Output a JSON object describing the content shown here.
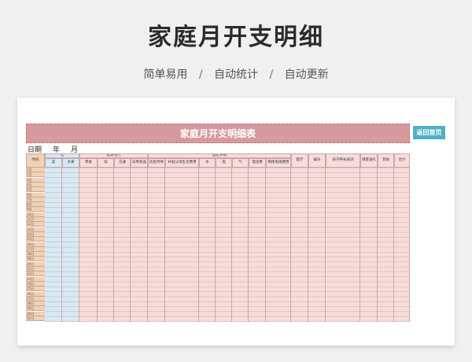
{
  "title": "家庭月开支明细",
  "subtitle": [
    "简单易用",
    "自动统计",
    "自动更新"
  ],
  "subtitle_sep": "/",
  "sheet": {
    "banner": "家庭月开支明细表",
    "home_button": "返回首页",
    "date_label": "日期",
    "year_label": "年",
    "month_label": "月",
    "headers": {
      "time": "时间",
      "eat": "吃",
      "vegetables": "菜",
      "fruit": "水果",
      "living_group": "给穿住行",
      "snacks": "零食",
      "wear": "穿",
      "transport": "交通",
      "daily_goods": "日用商品",
      "fixed_group": "固定开销",
      "rent": "房屋月供",
      "parents": "补贴父母生活费用",
      "water": "水",
      "electricity": "电",
      "gas": "气",
      "phone": "电话费",
      "internet": "网络电视费用",
      "medical": "医疗",
      "entertainment": "娱乐",
      "child_training": "孩子特长培训",
      "gifts": "请客送礼",
      "other": "其他",
      "total": "合计"
    },
    "days": [
      "1日",
      "2日",
      "3日",
      "4日",
      "5日",
      "6日",
      "7日",
      "8日",
      "9日",
      "10日",
      "11日",
      "12日",
      "13日",
      "14日",
      "15日",
      "16日",
      "17日",
      "18日",
      "19日",
      "20日",
      "21日",
      "22日",
      "23日",
      "24日",
      "25日",
      "26日",
      "27日",
      "28日",
      "29日",
      "30日",
      "31日"
    ],
    "colors": {
      "banner": "#d6999c",
      "pink_fill": "#f8dcdc",
      "blue_fill": "#d6eaf5",
      "time_fill": "#f2d0b2",
      "button": "#4db0c5"
    }
  }
}
